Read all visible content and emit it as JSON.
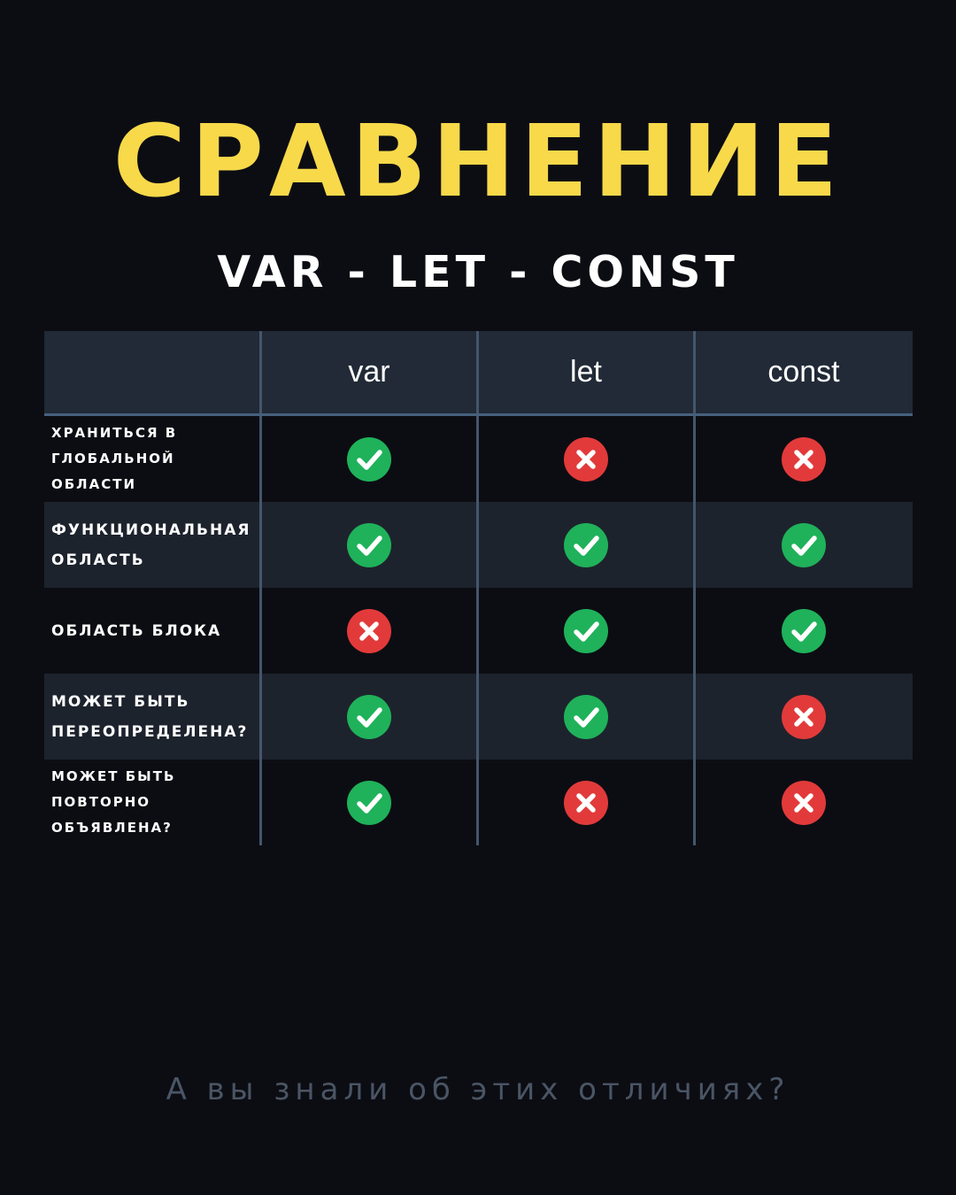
{
  "title": "СРАВНЕНИЕ",
  "subtitle": "VAR - LET - CONST",
  "table": {
    "columns": [
      "var",
      "let",
      "const"
    ],
    "rows": [
      {
        "label": "ХРАНИТЬСЯ В ГЛОБАЛЬНОЙ ОБЛАСТИ",
        "values": [
          "check",
          "cross",
          "cross"
        ]
      },
      {
        "label": "ФУНКЦИОНАЛЬНАЯ ОБЛАСТЬ",
        "values": [
          "check",
          "check",
          "check"
        ]
      },
      {
        "label": "ОБЛАСТЬ БЛОКА",
        "values": [
          "cross",
          "check",
          "check"
        ]
      },
      {
        "label": "МОЖЕТ БЫТЬ ПЕРЕОПРЕДЕЛЕНА?",
        "values": [
          "check",
          "check",
          "cross"
        ]
      },
      {
        "label": "МОЖЕТ БЫТЬ ПОВТОРНО ОБЪЯВЛЕНА?",
        "values": [
          "check",
          "cross",
          "cross"
        ]
      }
    ]
  },
  "footer": "А вы знали об этих отличиях?",
  "colors": {
    "background": "#0c0d13",
    "title": "#f7d94a",
    "check": "#1fb25a",
    "cross": "#e23a3a"
  }
}
